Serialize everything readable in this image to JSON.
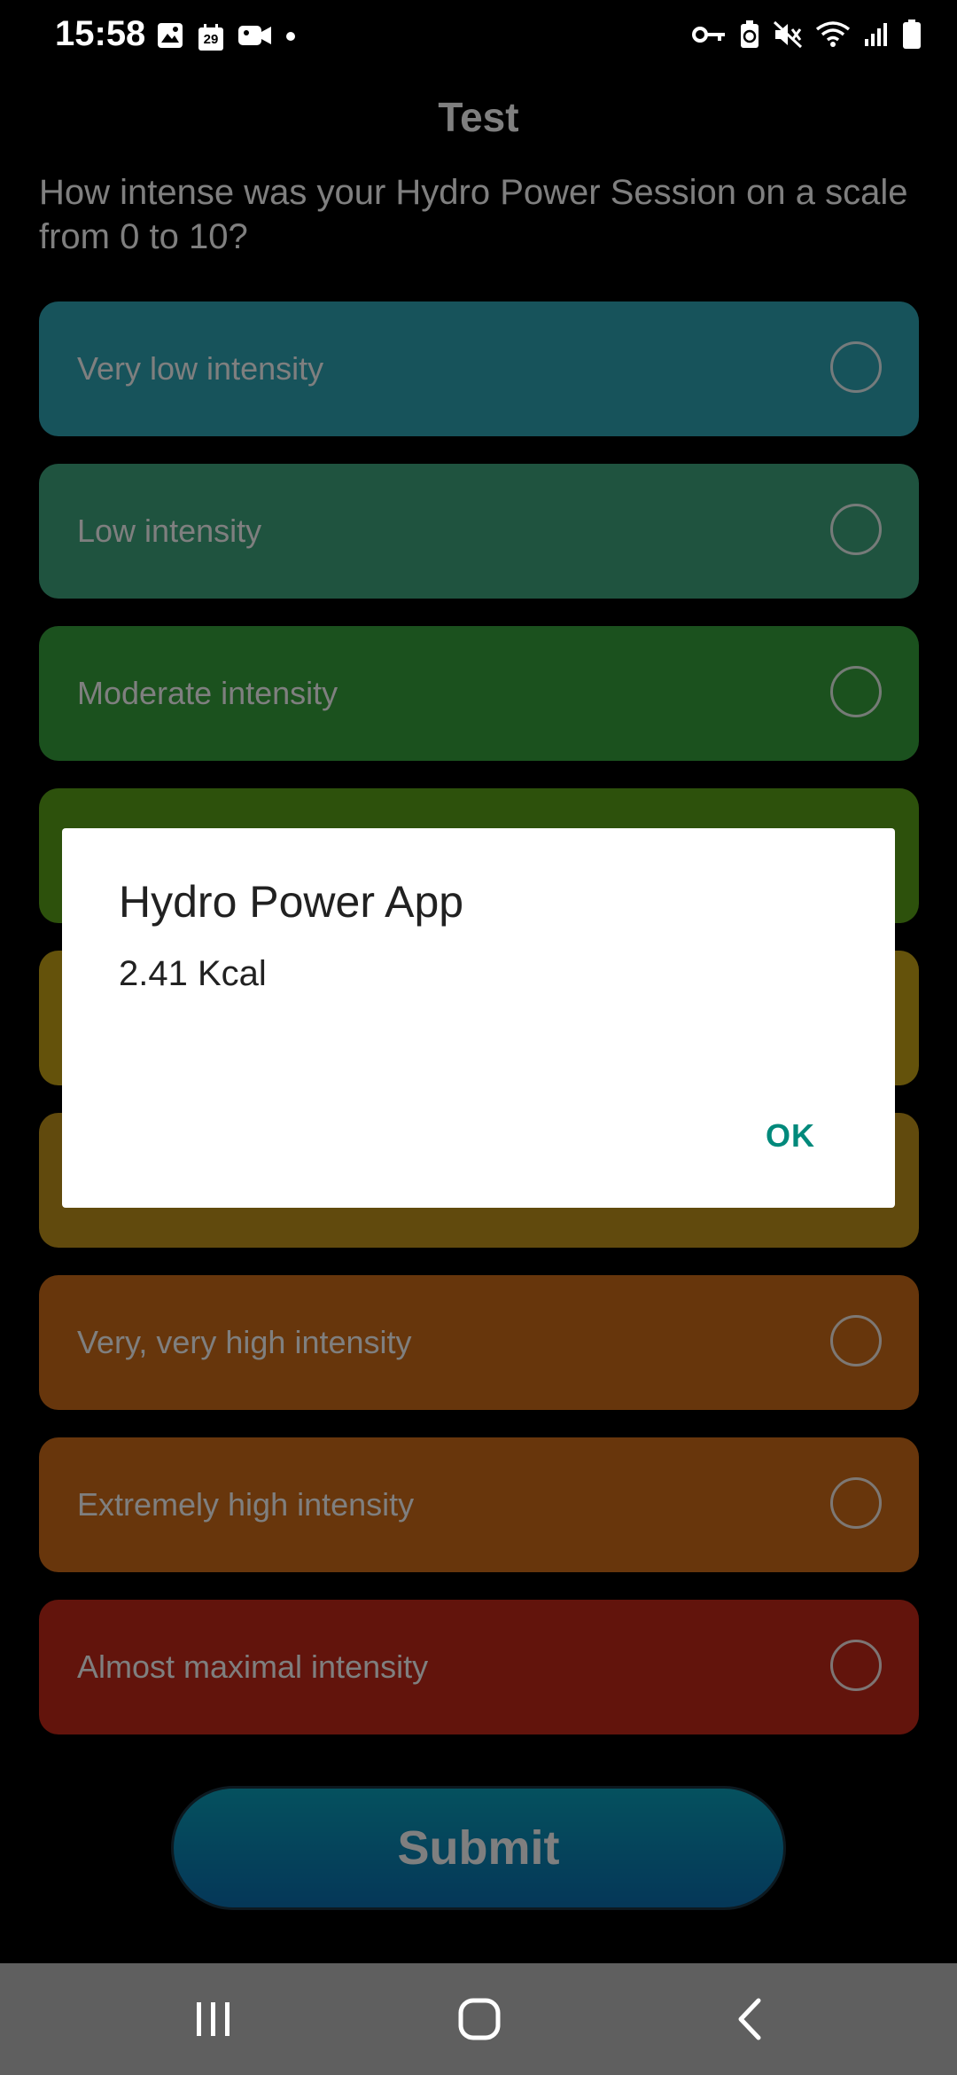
{
  "status_bar": {
    "time": "15:58",
    "calendar_day": "29",
    "left_icons": [
      "gallery-icon",
      "calendar-icon",
      "video-icon",
      "dot-icon"
    ],
    "right_icons": [
      "vpn-key-icon",
      "battery-saver-icon",
      "mute-icon",
      "wifi-icon",
      "signal-icon",
      "battery-icon"
    ]
  },
  "page": {
    "title": "Test",
    "question": "How intense was your Hydro Power Session on a scale from 0 to 10?",
    "options": [
      {
        "label": "Very low intensity",
        "color": "#2fa7b6"
      },
      {
        "label": "Low intensity",
        "color": "#3fa77f"
      },
      {
        "label": "Moderate intensity",
        "color": "#36a23d"
      },
      {
        "label": "",
        "color": "#5aa218"
      },
      {
        "label": "",
        "color": "#c8a416"
      },
      {
        "label": "",
        "color": "#c3951b"
      },
      {
        "label": "Very, very high intensity",
        "color": "#ce6c18"
      },
      {
        "label": "Extremely high intensity",
        "color": "#d16d18"
      },
      {
        "label": "Almost maximal intensity",
        "color": "#c52818"
      }
    ],
    "submit_label": "Submit"
  },
  "dialog": {
    "title": "Hydro Power App",
    "message": "2.41 Kcal",
    "ok_label": "OK"
  },
  "nav_bar": {
    "icons": [
      "recents-icon",
      "home-icon",
      "back-icon"
    ]
  }
}
